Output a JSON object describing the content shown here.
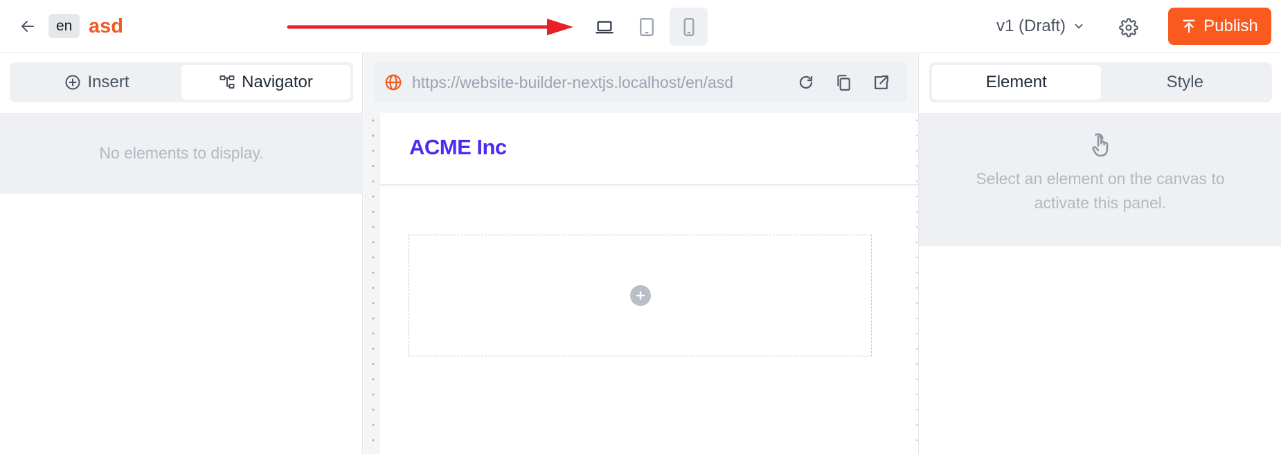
{
  "topbar": {
    "locale": "en",
    "site_name": "asd",
    "version_label": "v1 (Draft)",
    "publish_label": "Publish",
    "devices": [
      "laptop-icon",
      "tablet-icon",
      "phone-icon"
    ],
    "active_device": "phone"
  },
  "left_panel": {
    "tabs": [
      {
        "label": "Insert",
        "icon": "plus-circle-icon",
        "active": false
      },
      {
        "label": "Navigator",
        "icon": "tree-structure-icon",
        "active": true
      }
    ],
    "empty_text": "No elements to display."
  },
  "canvas": {
    "url": "https://website-builder-nextjs.localhost/en/asd",
    "brand": "ACME Inc"
  },
  "right_panel": {
    "tabs": [
      {
        "label": "Element",
        "active": true
      },
      {
        "label": "Style",
        "active": false
      }
    ],
    "empty_text": "Select an element on the canvas to activate this panel."
  },
  "colors": {
    "accent": "#fa5a1f",
    "brand": "#4b2cf2",
    "annotation_arrow": "#e8202a"
  }
}
